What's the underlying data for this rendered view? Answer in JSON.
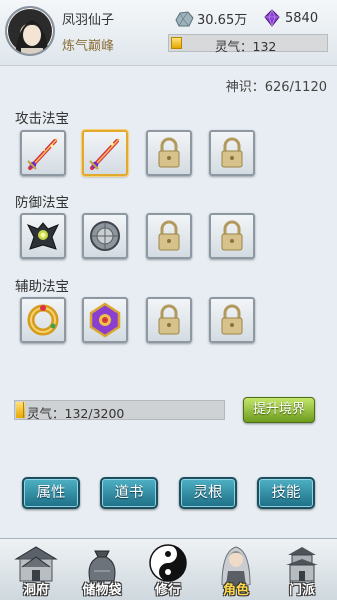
{
  "header": {
    "player_name": "凤羽仙子",
    "rank": "炼气巅峰",
    "spirit_stones": "30.65万",
    "gems": "5840",
    "lingqi_label": "灵气：132"
  },
  "sense": "神识：626/1120",
  "sections": {
    "attack": {
      "title": "攻击法宝"
    },
    "defense": {
      "title": "防御法宝"
    },
    "support": {
      "title": "辅助法宝"
    }
  },
  "progress": {
    "label": "灵气：132/3200",
    "current": 132,
    "max": 3200
  },
  "buttons": {
    "upgrade": "提升境界",
    "attributes": "属性",
    "daoshu": "道书",
    "linggen": "灵根",
    "skills": "技能"
  },
  "nav": {
    "items": [
      {
        "label": "洞府",
        "icon": "cave-house-icon"
      },
      {
        "label": "储物袋",
        "icon": "storage-bag-icon"
      },
      {
        "label": "修行",
        "icon": "taiji-icon"
      },
      {
        "label": "角色",
        "icon": "character-icon"
      },
      {
        "label": "门派",
        "icon": "sect-pagoda-icon"
      }
    ],
    "active": "角色"
  },
  "colors": {
    "tab_button": "#1d6f86",
    "upgrade_button": "#6e9c1e",
    "progress_fill": "#e6a800",
    "rank_text": "#8b6f3a"
  }
}
